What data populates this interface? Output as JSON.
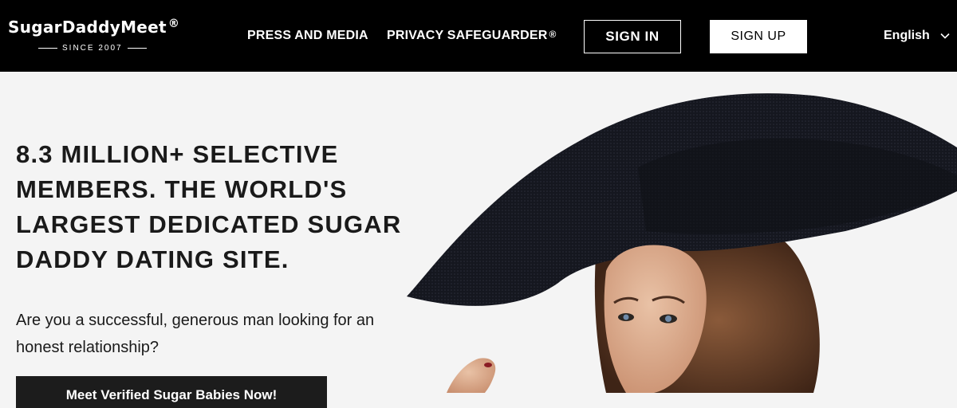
{
  "header": {
    "logo": {
      "name": "SugarDaddyMeet",
      "reg_mark": "®",
      "tagline": "SINCE 2007"
    },
    "nav": [
      {
        "label": "PRESS AND MEDIA"
      },
      {
        "label": "PRIVACY SAFEGUARDER",
        "reg_mark": "®"
      }
    ],
    "sign_in_label": "SIGN IN",
    "sign_up_label": "SIGN UP",
    "language": {
      "selected": "English",
      "icon": "chevron-down-icon"
    }
  },
  "hero": {
    "headline": "8.3 MILLION+ SELECTIVE MEMBERS. THE WORLD'S LARGEST DEDICATED SUGAR DADDY DATING SITE.",
    "subheadline": "Are you a successful, generous man looking for an honest relationship?",
    "cta_label": "Meet Verified Sugar Babies Now!",
    "image_subject": "woman-in-wide-brim-black-hat"
  },
  "colors": {
    "header_bg": "#000000",
    "page_bg": "#f4f4f4",
    "text": "#1a1a1a",
    "cta_bg": "#1c1c1c"
  }
}
